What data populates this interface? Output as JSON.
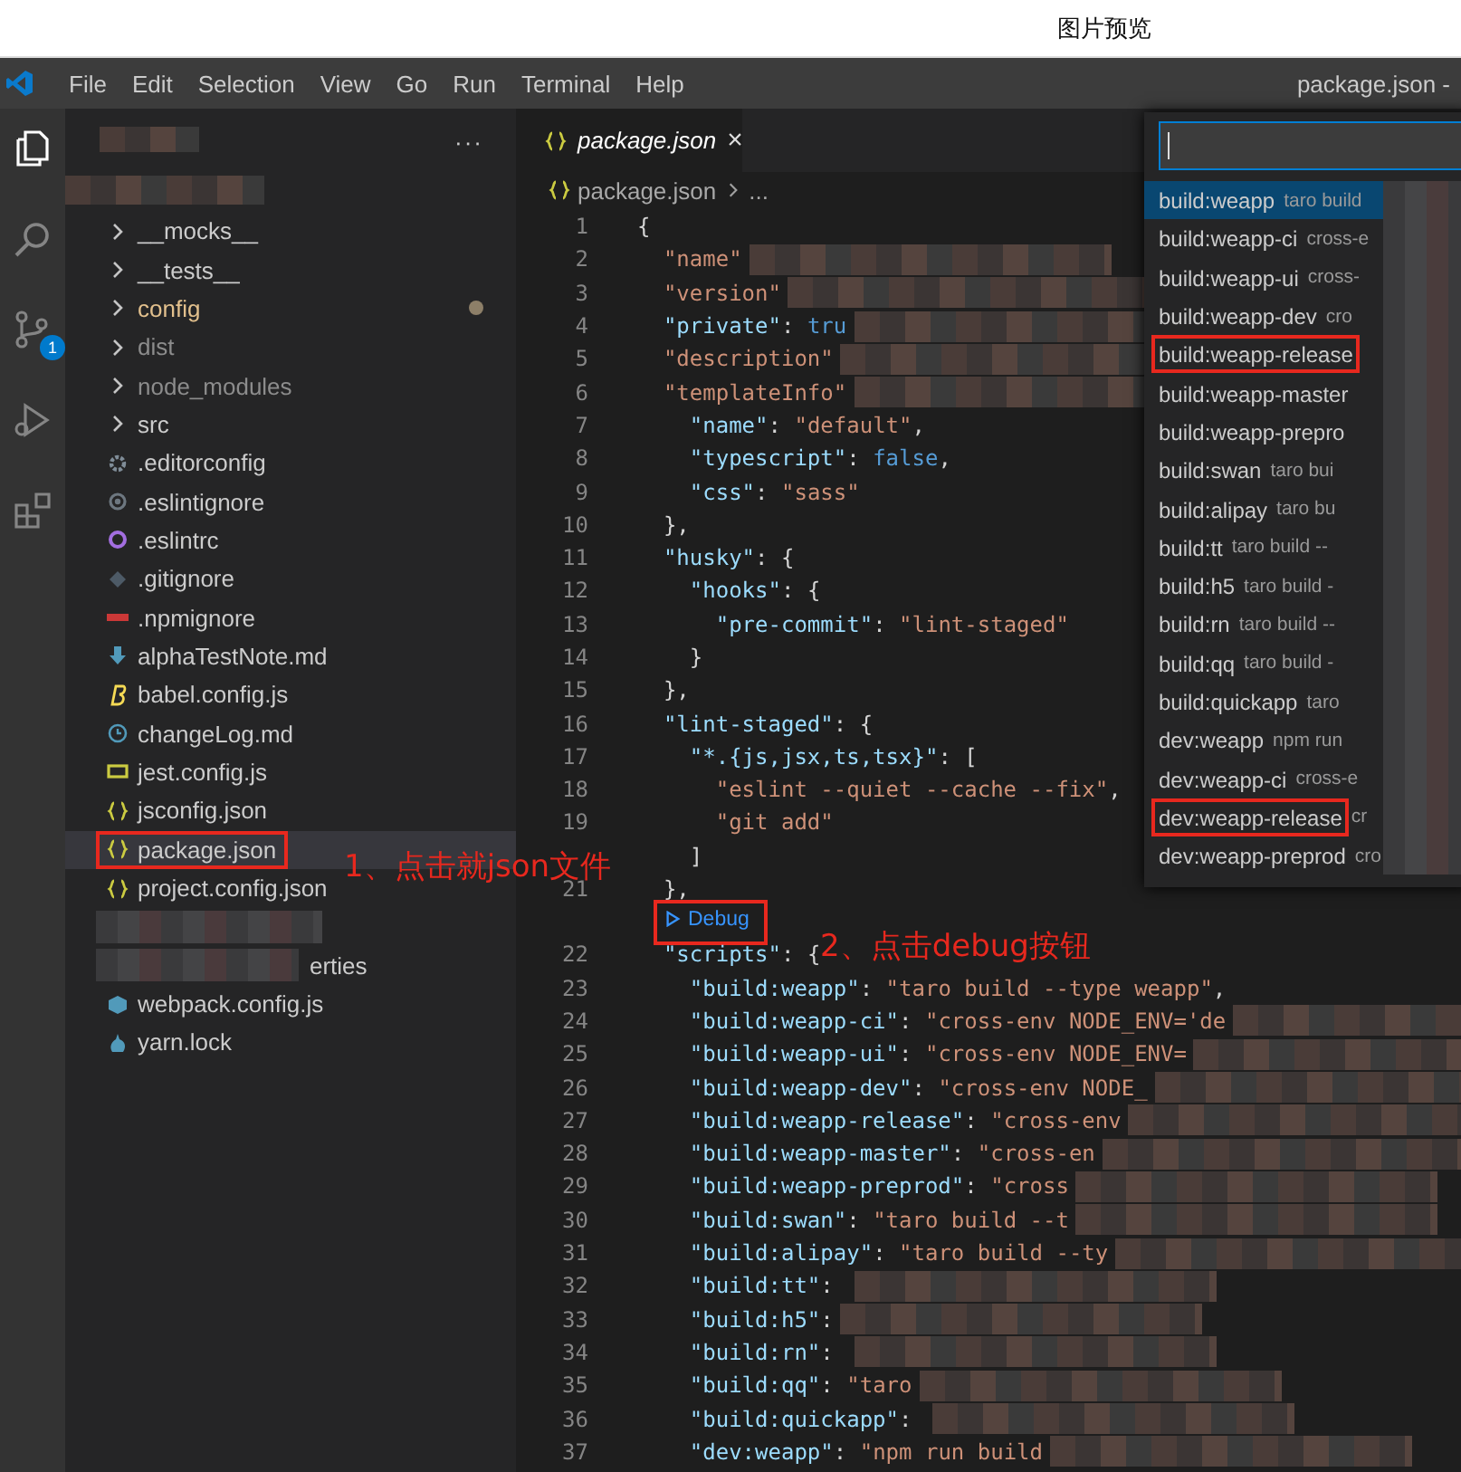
{
  "window": {
    "title": "图片预览",
    "editor_title": "package.json -"
  },
  "menu": [
    "File",
    "Edit",
    "Selection",
    "View",
    "Go",
    "Run",
    "Terminal",
    "Help"
  ],
  "activity_bar": {
    "scm_badge": "1"
  },
  "sidebar": {
    "more": "···",
    "items": [
      {
        "label": "__mocks__",
        "kind": "folder",
        "modified": false,
        "ignored": false,
        "selected": false,
        "marked": false
      },
      {
        "label": "__tests__",
        "kind": "folder",
        "modified": false,
        "ignored": false,
        "selected": false,
        "marked": false
      },
      {
        "label": "config",
        "kind": "folder",
        "modified": true,
        "ignored": false,
        "selected": false,
        "marked": false
      },
      {
        "label": "dist",
        "kind": "folder",
        "modified": false,
        "ignored": true,
        "selected": false,
        "marked": false
      },
      {
        "label": "node_modules",
        "kind": "folder",
        "modified": false,
        "ignored": true,
        "selected": false,
        "marked": false
      },
      {
        "label": "src",
        "kind": "folder",
        "modified": false,
        "ignored": false,
        "selected": false,
        "marked": false
      },
      {
        "label": ".editorconfig",
        "kind": "settings",
        "modified": false,
        "ignored": false,
        "selected": false,
        "marked": false
      },
      {
        "label": ".eslintignore",
        "kind": "ring",
        "modified": false,
        "ignored": false,
        "selected": false,
        "marked": false
      },
      {
        "label": ".eslintrc",
        "kind": "ring-accent",
        "modified": false,
        "ignored": false,
        "selected": false,
        "marked": false
      },
      {
        "label": ".gitignore",
        "kind": "diamond",
        "modified": false,
        "ignored": false,
        "selected": false,
        "marked": false
      },
      {
        "label": ".npmignore",
        "kind": "logo",
        "modified": false,
        "ignored": false,
        "selected": false,
        "marked": false
      },
      {
        "label": "alphaTestNote.md",
        "kind": "arrow",
        "modified": false,
        "ignored": false,
        "selected": false,
        "marked": false
      },
      {
        "label": "babel.config.js",
        "kind": "script",
        "modified": false,
        "ignored": false,
        "selected": false,
        "marked": false
      },
      {
        "label": "changeLog.md",
        "kind": "clock",
        "modified": false,
        "ignored": false,
        "selected": false,
        "marked": false
      },
      {
        "label": "jest.config.js",
        "kind": "js",
        "modified": false,
        "ignored": false,
        "selected": false,
        "marked": false
      },
      {
        "label": "jsconfig.json",
        "kind": "json",
        "modified": false,
        "ignored": false,
        "selected": false,
        "marked": false
      },
      {
        "label": "package.json",
        "kind": "json",
        "modified": false,
        "ignored": false,
        "selected": true,
        "marked": true
      },
      {
        "label": "project.config.json",
        "kind": "json",
        "modified": false,
        "ignored": false,
        "selected": false,
        "marked": false
      },
      {
        "kind": "redacted",
        "selected": false
      },
      {
        "label": "erties",
        "kind": "partial",
        "modified": false,
        "ignored": false,
        "selected": false,
        "marked": false
      },
      {
        "label": "webpack.config.js",
        "kind": "cube",
        "modified": false,
        "ignored": false,
        "selected": false,
        "marked": false
      },
      {
        "label": "yarn.lock",
        "kind": "ball",
        "modified": false,
        "ignored": false,
        "selected": false,
        "marked": false
      }
    ]
  },
  "tab": {
    "label": "package.json",
    "close": "×"
  },
  "breadcrumb": [
    "package.json",
    "..."
  ],
  "code": [
    {
      "n": "1",
      "text": "{",
      "redacted": false
    },
    {
      "n": "2",
      "text": "  \"name\"",
      "redacted": true
    },
    {
      "n": "3",
      "text": "  \"version\"",
      "redacted": true
    },
    {
      "n": "4",
      "text": "  \"private\": tru",
      "redacted": true
    },
    {
      "n": "5",
      "text": "  \"description\"",
      "redacted": true
    },
    {
      "n": "6",
      "text": "  \"templateInfo\"",
      "redacted": true
    },
    {
      "n": "7",
      "text": "    \"name\": \"default\",",
      "redacted": false
    },
    {
      "n": "8",
      "text": "    \"typescript\": false,",
      "redacted": false
    },
    {
      "n": "9",
      "text": "    \"css\": \"sass\"",
      "redacted": false
    },
    {
      "n": "10",
      "text": "  },",
      "redacted": false
    },
    {
      "n": "11",
      "text": "  \"husky\": {",
      "redacted": false
    },
    {
      "n": "12",
      "text": "    \"hooks\": {",
      "redacted": false
    },
    {
      "n": "13",
      "text": "      \"pre-commit\": \"lint-staged\"",
      "redacted": false
    },
    {
      "n": "14",
      "text": "    }",
      "redacted": false
    },
    {
      "n": "15",
      "text": "  },",
      "redacted": false
    },
    {
      "n": "16",
      "text": "  \"lint-staged\": {",
      "redacted": false
    },
    {
      "n": "17",
      "text": "    \"*.{js,jsx,ts,tsx}\": [",
      "redacted": false
    },
    {
      "n": "18",
      "text": "      \"eslint --quiet --cache --fix\",",
      "redacted": false
    },
    {
      "n": "19",
      "text": "      \"git add\"",
      "redacted": false
    },
    {
      "text": "    ]",
      "redacted": false
    },
    {
      "n": "21",
      "text": "  },",
      "redacted": false
    },
    {
      "kind": "codelens",
      "label": "Debug",
      "marked": true
    },
    {
      "n": "22",
      "text": "  \"scripts\": {",
      "redacted": false
    },
    {
      "n": "23",
      "text": "    \"build:weapp\": \"taro build --type weapp\",",
      "redacted": false
    },
    {
      "n": "24",
      "text": "    \"build:weapp-ci\": \"cross-env NODE_ENV='de",
      "redacted": true
    },
    {
      "n": "25",
      "text": "    \"build:weapp-ui\": \"cross-env NODE_ENV=",
      "redacted": true
    },
    {
      "n": "26",
      "text": "    \"build:weapp-dev\": \"cross-env NODE_",
      "redacted": true
    },
    {
      "n": "27",
      "text": "    \"build:weapp-release\": \"cross-env",
      "redacted": true
    },
    {
      "n": "28",
      "text": "    \"build:weapp-master\": \"cross-en",
      "redacted": true
    },
    {
      "n": "29",
      "text": "    \"build:weapp-preprod\": \"cross",
      "redacted": true
    },
    {
      "n": "30",
      "text": "    \"build:swan\": \"taro build --t",
      "redacted": true
    },
    {
      "n": "31",
      "text": "    \"build:alipay\": \"taro build --ty",
      "redacted": true
    },
    {
      "n": "32",
      "text": "    \"build:tt\": ",
      "redacted": true
    },
    {
      "n": "33",
      "text": "    \"build:h5\":",
      "redacted": true
    },
    {
      "n": "34",
      "text": "    \"build:rn\": ",
      "redacted": true
    },
    {
      "n": "35",
      "text": "    \"build:qq\": \"taro",
      "redacted": true
    },
    {
      "n": "36",
      "text": "    \"build:quickapp\": ",
      "redacted": true
    },
    {
      "n": "37",
      "text": "    \"dev:weapp\": \"npm run build",
      "redacted": true
    }
  ],
  "picker": {
    "items": [
      {
        "name": "build:weapp",
        "desc": "taro build",
        "selected": true,
        "marked": false
      },
      {
        "name": "build:weapp-ci",
        "desc": "cross-e",
        "selected": false,
        "marked": false
      },
      {
        "name": "build:weapp-ui",
        "desc": "cross-",
        "selected": false,
        "marked": false
      },
      {
        "name": "build:weapp-dev",
        "desc": "cro",
        "selected": false,
        "marked": false
      },
      {
        "name": "build:weapp-release",
        "selected": false,
        "marked": true
      },
      {
        "name": "build:weapp-master",
        "selected": false,
        "marked": false
      },
      {
        "name": "build:weapp-prepro",
        "selected": false,
        "marked": false
      },
      {
        "name": "build:swan",
        "desc": "taro bui",
        "selected": false,
        "marked": false
      },
      {
        "name": "build:alipay",
        "desc": "taro bu",
        "selected": false,
        "marked": false
      },
      {
        "name": "build:tt",
        "desc": "taro build --",
        "selected": false,
        "marked": false
      },
      {
        "name": "build:h5",
        "desc": "taro build -",
        "selected": false,
        "marked": false
      },
      {
        "name": "build:rn",
        "desc": "taro build --",
        "selected": false,
        "marked": false
      },
      {
        "name": "build:qq",
        "desc": "taro build -",
        "selected": false,
        "marked": false
      },
      {
        "name": "build:quickapp",
        "desc": "taro",
        "selected": false,
        "marked": false
      },
      {
        "name": "dev:weapp",
        "desc": "npm run",
        "selected": false,
        "marked": false
      },
      {
        "name": "dev:weapp-ci",
        "desc": "cross-e",
        "selected": false,
        "marked": false
      },
      {
        "name": "dev:weapp-release",
        "desc": "cr",
        "selected": false,
        "marked": true
      },
      {
        "name": "dev:weapp-preprod",
        "desc": "cro",
        "selected": false,
        "marked": false
      }
    ]
  },
  "annotations": [
    {
      "text": "1、点击就json文件"
    },
    {
      "text": "2、点击debug按钮"
    }
  ]
}
